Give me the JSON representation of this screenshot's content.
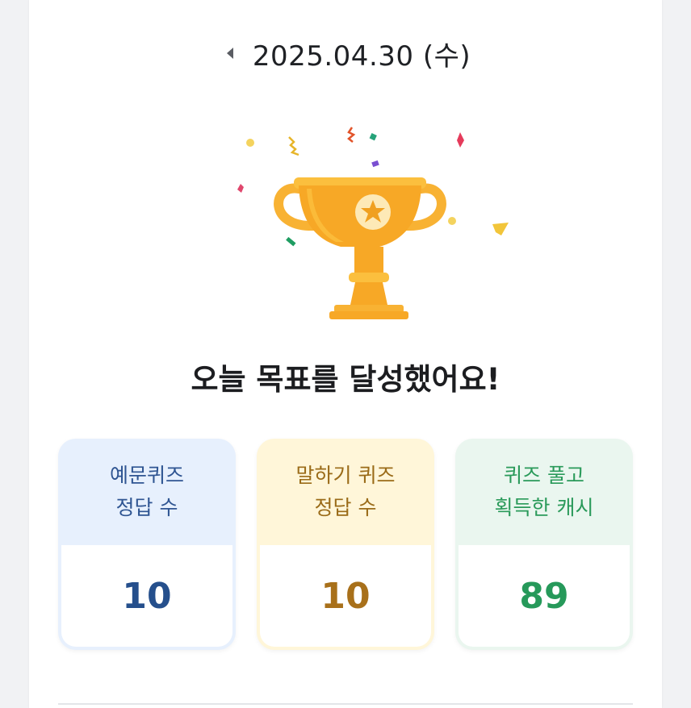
{
  "header": {
    "date": "2025.04.30 (수)"
  },
  "hero": {
    "headline": "오늘 목표를 달성했어요!"
  },
  "stats": [
    {
      "label_line1": "예문퀴즈",
      "label_line2": "정답 수",
      "value": "10"
    },
    {
      "label_line1": "말하기 퀴즈",
      "label_line2": "정답 수",
      "value": "10"
    },
    {
      "label_line1": "퀴즈 풀고",
      "label_line2": "획득한 캐시",
      "value": "89"
    }
  ],
  "colors": {
    "trophy": "#f7a826",
    "trophy_light": "#fbbf3e",
    "blue_card": "#e7f0fd",
    "yellow_card": "#fff6d9",
    "green_card": "#eaf6ef"
  },
  "icons": {
    "prev": "caret-left-icon",
    "trophy": "trophy-illustration",
    "confetti": "confetti-icon"
  }
}
